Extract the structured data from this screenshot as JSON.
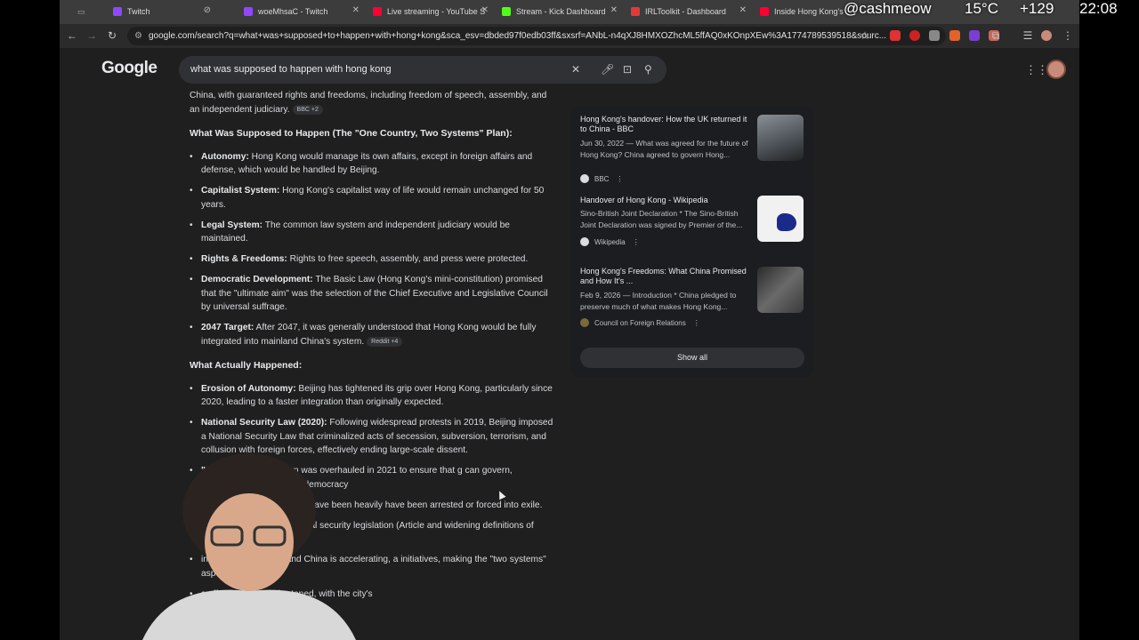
{
  "tabs": [
    {
      "title": "Twitch",
      "color": "#9146ff"
    },
    {
      "title": "woeMhsaC - Twitch",
      "color": "#9146ff"
    },
    {
      "title": "Live streaming - YouTube S",
      "color": "#ff0033"
    },
    {
      "title": "Stream - Kick Dashboard",
      "color": "#53fc18"
    },
    {
      "title": "IRLToolkit - Dashboard",
      "color": "#e53935"
    },
    {
      "title": "Inside Hong Kong's C",
      "color": "#ff0033"
    }
  ],
  "address_bar": {
    "url": "google.com/search?q=what+was+supposed+to+happen+with+hong+kong&sca_esv=dbded97f0edb03ff&sxsrf=ANbL-n4qXJ8HMXOZhcML5ffAQ0xKOnpXEw%3A1774789539518&sourc..."
  },
  "google": {
    "logo": "Google",
    "query": "what was supposed to happen with hong kong"
  },
  "ai_overview": {
    "intro": "China, with guaranteed rights and freedoms, including freedom of speech, assembly, and an independent judiciary.",
    "intro_chip": "BBC +2",
    "section1_title": "What Was Supposed to Happen (The \"One Country, Two Systems\" Plan):",
    "section1_items": [
      {
        "bold": "Autonomy:",
        "text": " Hong Kong would manage its own affairs, except in foreign affairs and defense, which would be handled by Beijing."
      },
      {
        "bold": "Capitalist System:",
        "text": " Hong Kong's capitalist way of life would remain unchanged for 50 years."
      },
      {
        "bold": "Legal System:",
        "text": " The common law system and independent judiciary would be maintained."
      },
      {
        "bold": "Rights & Freedoms:",
        "text": " Rights to free speech, assembly, and press were protected."
      },
      {
        "bold": "Democratic Development:",
        "text": " The Basic Law (Hong Kong's mini-constitution) promised that the \"ultimate aim\" was the selection of the Chief Executive and Legislative Council by universal suffrage."
      },
      {
        "bold": "2047 Target:",
        "text": " After 2047, it was generally understood that Hong Kong would be fully integrated into mainland China's system."
      }
    ],
    "section1_chip": "Reddit +4",
    "section2_title": "What Actually Happened:",
    "section2_items": [
      {
        "bold": "Erosion of Autonomy:",
        "text": " Beijing has tightened its grip over Hong Kong, particularly since 2020, leading to a faster integration than originally expected."
      },
      {
        "bold": "National Security Law (2020):",
        "text": " Following widespread protests in 2019, Beijing imposed a National Security Law that criminalized acts of secession, subversion, terrorism, and collusion with foreign forces, effectively ending large-scale dissent."
      },
      {
        "bold": "\"Patri",
        "text": "e electoral system was overhauled in 2021 to ensure that g can govern, significantly reducing pro-democracy"
      },
      {
        "bold": "",
        "text": "and public demonstrations have been heavily have been arrested or forced into exile."
      },
      {
        "bold": "",
        "text": "Kong passed further national security legislation (Article and widening definitions of espionage and treason."
      },
      {
        "bold": "",
        "text": "integration with mainland China is accelerating, a initiatives, making the \"two systems\" aspect"
      },
      {
        "bold": "",
        "text": "s effectively been shortened, with the city's"
      }
    ]
  },
  "sources": [
    {
      "title": "Hong Kong's handover: How the UK returned it to China - BBC",
      "snippet": "Jun 30, 2022 — What was agreed for the future of Hong Kong? China agreed to govern Hong...",
      "source": "BBC",
      "color": "#5f6368"
    },
    {
      "title": "Handover of Hong Kong - Wikipedia",
      "snippet": "Sino-British Joint Declaration * The Sino-British Joint Declaration was signed by Premier of the...",
      "source": "Wikipedia",
      "color": "#dadce0"
    },
    {
      "title": "Hong Kong's Freedoms: What China Promised and How It's ...",
      "snippet": "Feb 9, 2026 — Introduction * China pledged to preserve much of what makes Hong Kong...",
      "source": "Council on Foreign Relations",
      "color": "#7a6a3a"
    }
  ],
  "show_all": "Show all",
  "stream_overlay": {
    "handle": "@cashmeow",
    "temperature": "15°C",
    "count": "+129",
    "time": "22:08"
  }
}
